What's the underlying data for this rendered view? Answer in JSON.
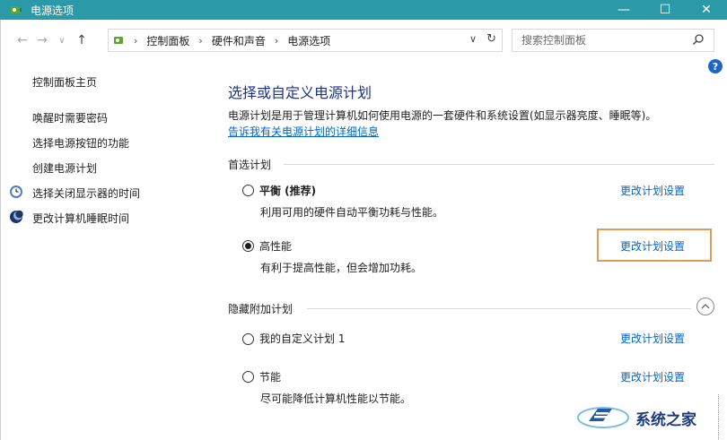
{
  "window": {
    "title": "电源选项",
    "controls": {
      "minimize": "—",
      "maximize": "☐",
      "close": "✕"
    }
  },
  "addressbar": {
    "breadcrumbs": [
      "控制面板",
      "硬件和声音",
      "电源选项"
    ],
    "search_placeholder": "搜索控制面板"
  },
  "sidebar": {
    "home_link": "控制面板主页",
    "items": [
      {
        "label": "唤醒时需要密码",
        "icon": ""
      },
      {
        "label": "选择电源按钮的功能",
        "icon": ""
      },
      {
        "label": "创建电源计划",
        "icon": ""
      },
      {
        "label": "选择关闭显示器的时间",
        "icon": "monitor-clock-icon"
      },
      {
        "label": "更改计算机睡眠时间",
        "icon": "moon-icon"
      }
    ]
  },
  "main": {
    "title": "选择或自定义电源计划",
    "description": "电源计划是用于管理计算机如何使用电源的一套硬件和系统设置(如显示器亮度、睡眠等)。",
    "info_link": "告诉我有关电源计划的详细信息",
    "preferred_section": {
      "header": "首选计划",
      "plans": [
        {
          "name": "平衡 (推荐)",
          "description": "利用可用的硬件自动平衡功耗与性能。",
          "selected": false,
          "link": "更改计划设置"
        },
        {
          "name": "高性能",
          "description": "有利于提高性能，但会增加功耗。",
          "selected": true,
          "link": "更改计划设置"
        }
      ]
    },
    "hidden_section": {
      "header": "隐藏附加计划",
      "plans": [
        {
          "name": "我的自定义计划 1",
          "description": "",
          "selected": false,
          "link": "更改计划设置"
        },
        {
          "name": "节能",
          "description": "尽可能降低计算机性能以节能。",
          "selected": false,
          "link": "更改计划设置"
        }
      ]
    }
  },
  "watermark": {
    "text": "系统之家"
  },
  "colors": {
    "titlebar": "#2b9aa8",
    "link": "#0066cc",
    "title": "#1e3287",
    "highlight": "#e09b55"
  }
}
